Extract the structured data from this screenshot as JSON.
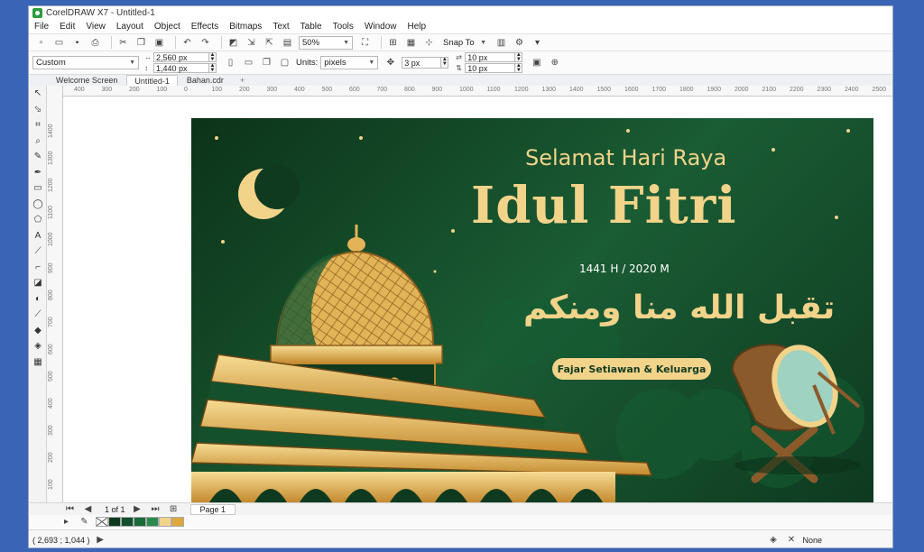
{
  "window": {
    "title": "CorelDRAW X7 - Untitled-1"
  },
  "menu": [
    "File",
    "Edit",
    "View",
    "Layout",
    "Object",
    "Effects",
    "Bitmaps",
    "Text",
    "Table",
    "Tools",
    "Window",
    "Help"
  ],
  "toolbar": {
    "zoom": "50%",
    "snap_to": "Snap To"
  },
  "propbar": {
    "preset": "Custom",
    "width": "2,560 px",
    "height": "1,440 px",
    "units_label": "Units:",
    "units": "pixels",
    "nudge": "3 px",
    "dup_x": "10 px",
    "dup_y": "10 px"
  },
  "tabs": [
    "Welcome Screen",
    "Untitled-1",
    "Bahan.cdr"
  ],
  "ruler": {
    "h_ticks": [
      "400",
      "300",
      "200",
      "100",
      "0",
      "100",
      "200",
      "300",
      "400",
      "500",
      "600",
      "700",
      "800",
      "900",
      "1000",
      "1100",
      "1200",
      "1300",
      "1400",
      "1500",
      "1600",
      "1700",
      "1800",
      "1900",
      "2000",
      "2100",
      "2200",
      "2300",
      "2400",
      "2500"
    ],
    "v_ticks": [
      "1400",
      "1300",
      "1200",
      "1100",
      "1000",
      "900",
      "800",
      "700",
      "600",
      "500",
      "400",
      "300",
      "200",
      "100"
    ]
  },
  "artwork": {
    "greeting": "Selamat Hari Raya",
    "title": "Idul Fitri",
    "year": "1441 H / 2020 M",
    "arabic": "تقبل الله منا ومنكم",
    "family": "Fajar Setiawan & Keluarga"
  },
  "pagebar": {
    "page_count": "1 of 1",
    "page_tab": "Page 1"
  },
  "palette": [
    "#ffffff",
    "#0d3a1f",
    "#12502b",
    "#1a6b3a",
    "#2c8a4e",
    "#f2d38a",
    "#e0a73c"
  ],
  "status": {
    "coords": "( 2,693 ; 1,044 )",
    "fill_label": "None"
  },
  "colors": {
    "bg_green": "#0e3a20",
    "gold": "#f2d38a"
  }
}
